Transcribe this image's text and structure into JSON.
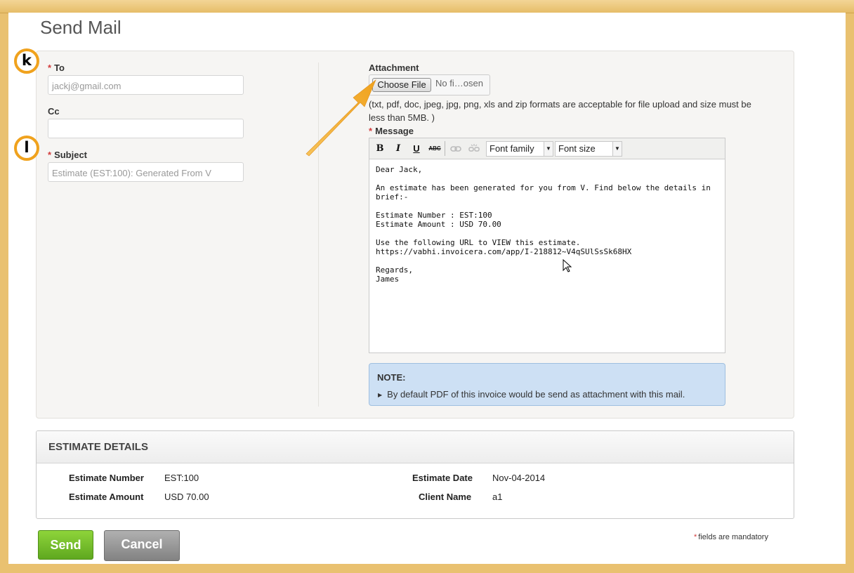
{
  "page": {
    "title": "Send Mail"
  },
  "markers": {
    "k": "k",
    "l": "l"
  },
  "form": {
    "to": {
      "label": "To",
      "required": "*",
      "value": "jackj@gmail.com"
    },
    "cc": {
      "label": "Cc",
      "value": ""
    },
    "subject": {
      "label": "Subject",
      "required": "*",
      "value": "Estimate (EST:100): Generated From V"
    },
    "attachment": {
      "label": "Attachment",
      "button": "Choose File",
      "status": "No fi…osen",
      "hint": "(txt, pdf, doc, jpeg, jpg, png, xls and zip formats are acceptable for file upload and size must be less than 5MB. )"
    },
    "message": {
      "label": "Message",
      "required": "*",
      "toolbar": {
        "bold": "B",
        "italic": "I",
        "underline": "U",
        "strike": "ABC",
        "link_icon": "link-icon",
        "unlink_icon": "unlink-icon",
        "font_family": "Font family",
        "font_size": "Font size"
      },
      "body": {
        "greeting": "Dear Jack,",
        "intro": "An estimate has been generated for you from V. Find below the details in brief:-",
        "number_line": "Estimate Number : EST:100",
        "amount_line": "Estimate Amount : USD 70.00",
        "url_intro": "Use the following URL to VIEW this estimate.",
        "url": "https://vabhi.invoicera.com/app/I-218812~V4qSUlSsSk68HX",
        "regards": "Regards,",
        "signature": "James"
      }
    },
    "note": {
      "title": "NOTE:",
      "text": "By default PDF of this invoice would be send as attachment with this mail."
    }
  },
  "estimate_details": {
    "title": "ESTIMATE DETAILS",
    "number": {
      "label": "Estimate Number",
      "value": "EST:100"
    },
    "amount": {
      "label": "Estimate Amount",
      "value": "USD 70.00"
    },
    "date": {
      "label": "Estimate Date",
      "value": "Nov-04-2014"
    },
    "client": {
      "label": "Client Name",
      "value": "a1"
    }
  },
  "actions": {
    "send": "Send",
    "cancel": "Cancel",
    "mandatory_star": "*",
    "mandatory_text": "fields are mandatory"
  },
  "colors": {
    "accent_orange": "#f0a21d",
    "send_green": "#6ab826",
    "note_blue": "#cde0f4",
    "required_red": "#d23c3c"
  }
}
